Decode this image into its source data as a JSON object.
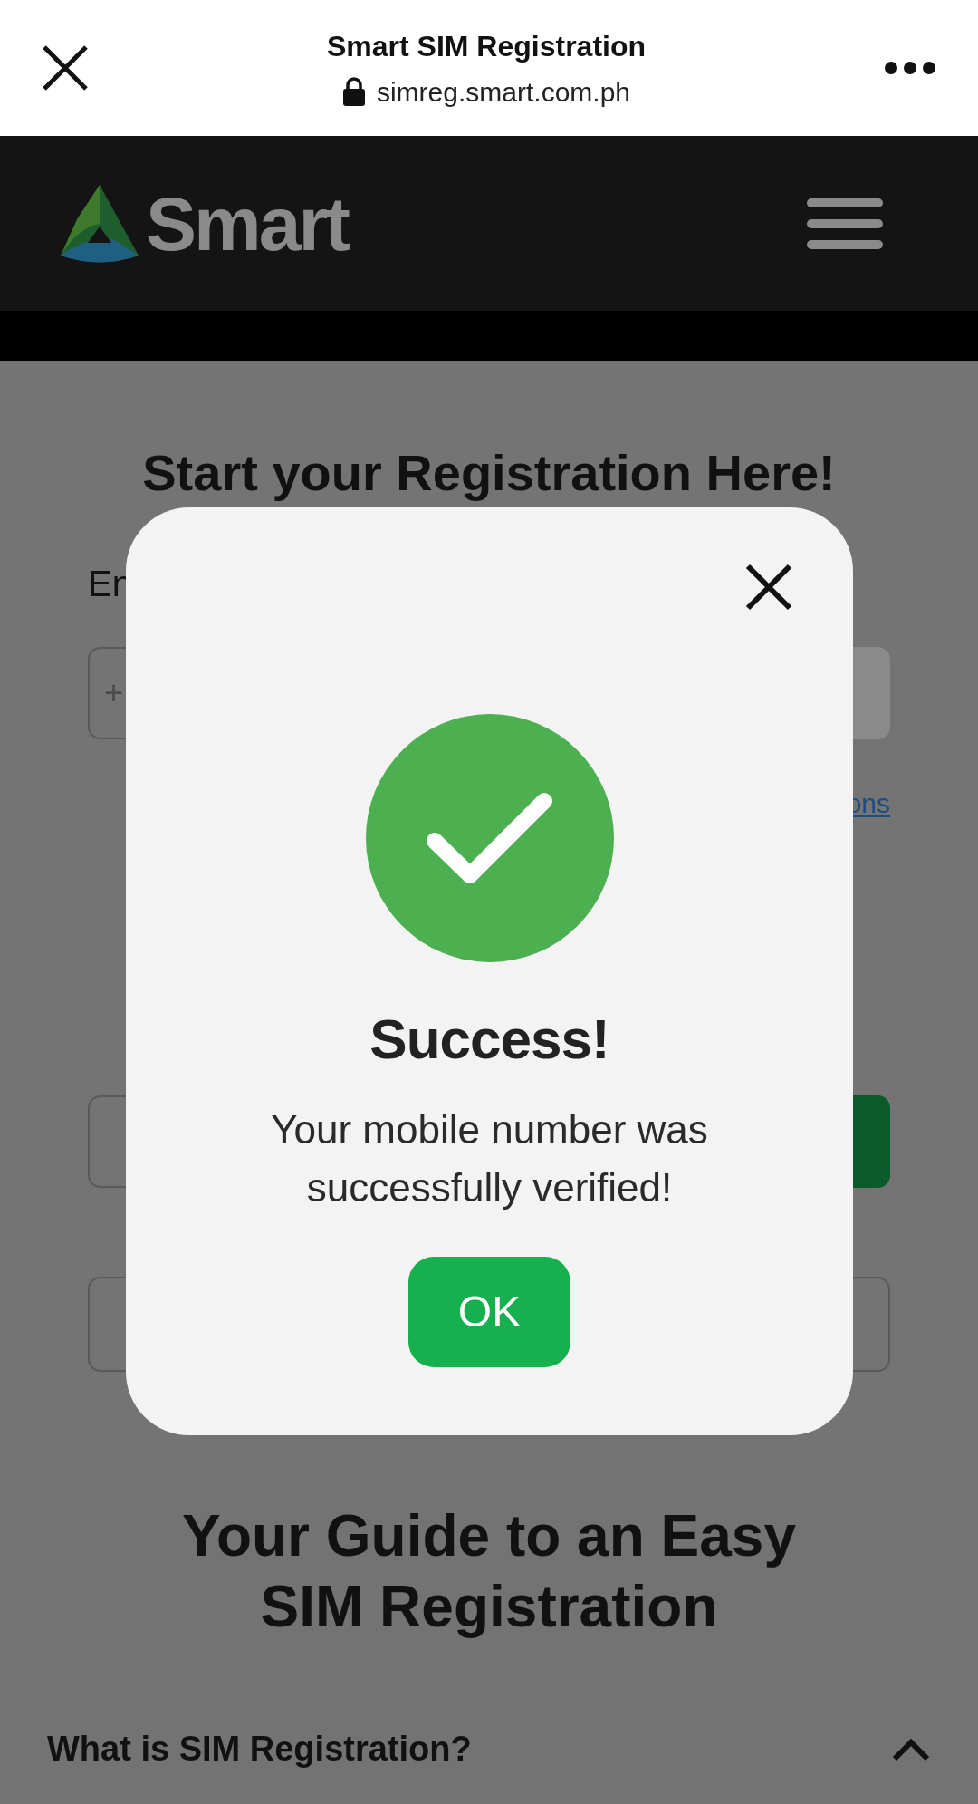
{
  "browser": {
    "title": "Smart SIM Registration",
    "url": "simreg.smart.com.ph"
  },
  "header": {
    "logo_text": "Smart"
  },
  "registration": {
    "heading": "Start your Registration Here!",
    "label": "En",
    "number_field": {
      "prefix": "+"
    },
    "link": "ons"
  },
  "dialog": {
    "title": "Success!",
    "message": "Your mobile number was successfully verified!",
    "ok_button": "OK"
  },
  "guide": {
    "heading": "Your Guide to an Easy SIM Registration",
    "faq": [
      {
        "question": "What is SIM Registration?",
        "expanded": true
      }
    ]
  }
}
